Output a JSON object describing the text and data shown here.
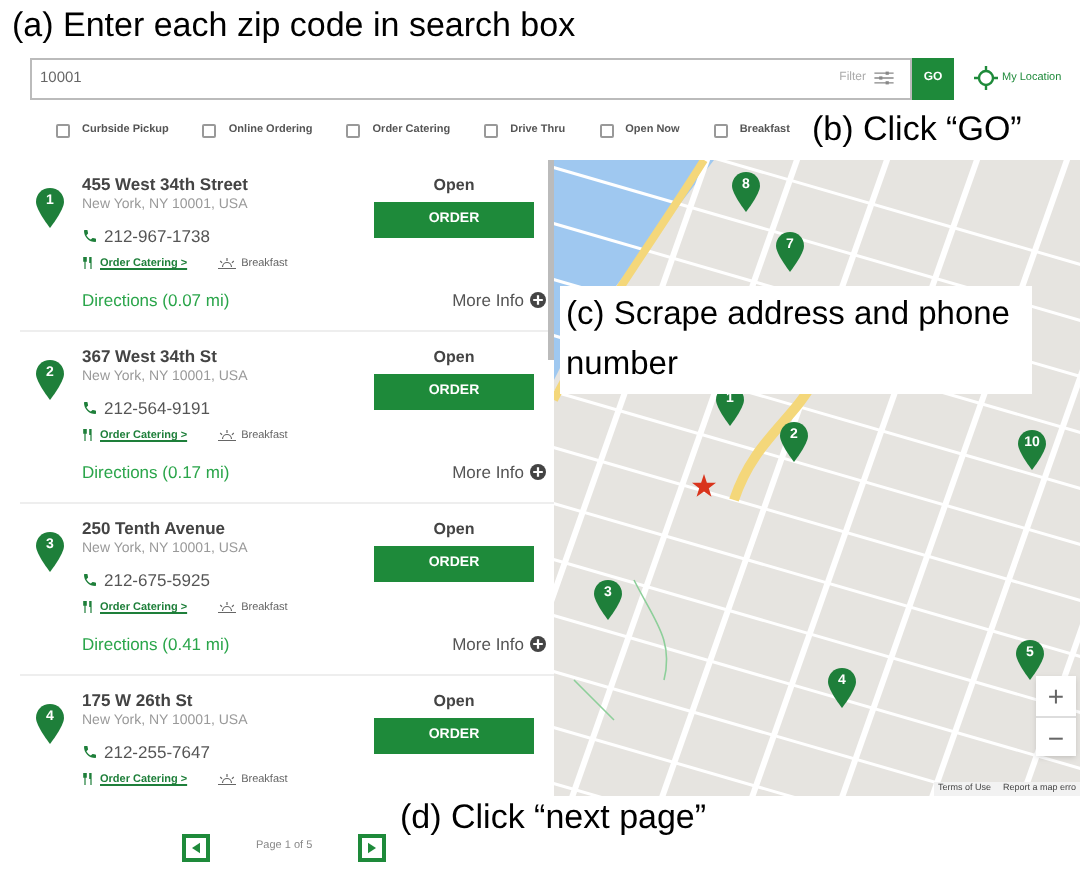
{
  "annotations": [
    {
      "text": "(a) Enter each zip code in search box"
    },
    {
      "text": "(b) Click “GO”"
    },
    {
      "text": "(c) Scrape address and phone number"
    },
    {
      "text": "(d) Click “next page”"
    }
  ],
  "search": {
    "value": "10001",
    "filter_label": "Filter",
    "button": "GO",
    "my_location": "My Location"
  },
  "filters": [
    {
      "label": "Curbside Pickup",
      "checked": false
    },
    {
      "label": "Online Ordering",
      "checked": false
    },
    {
      "label": "Order Catering",
      "checked": false
    },
    {
      "label": "Drive Thru",
      "checked": false
    },
    {
      "label": "Open Now",
      "checked": false
    },
    {
      "label": "Breakfast",
      "checked": false
    }
  ],
  "locations": [
    {
      "pin": "1",
      "name": "455 West 34th Street",
      "address": "New York, NY 10001, USA",
      "phone": "212-967-1738",
      "catering": "Order Catering >",
      "feature": "Breakfast",
      "status": "Open",
      "order": "ORDER",
      "directions": "Directions (0.07 mi)",
      "more_info": "More Info"
    },
    {
      "pin": "2",
      "name": "367 West 34th St",
      "address": "New York, NY 10001, USA",
      "phone": "212-564-9191",
      "catering": "Order Catering >",
      "feature": "Breakfast",
      "status": "Open",
      "order": "ORDER",
      "directions": "Directions (0.17 mi)",
      "more_info": "More Info"
    },
    {
      "pin": "3",
      "name": "250 Tenth Avenue",
      "address": "New York, NY 10001, USA",
      "phone": "212-675-5925",
      "catering": "Order Catering >",
      "feature": "Breakfast",
      "status": "Open",
      "order": "ORDER",
      "directions": "Directions (0.41 mi)",
      "more_info": "More Info"
    },
    {
      "pin": "4",
      "name": "175 W 26th St",
      "address": "New York, NY 10001, USA",
      "phone": "212-255-7647",
      "catering": "Order Catering >",
      "feature": "Breakfast",
      "status": "Open",
      "order": "ORDER"
    }
  ],
  "pagination": {
    "page_text": "Page 1 of 5"
  },
  "map": {
    "pins": [
      {
        "label": "8"
      },
      {
        "label": "7"
      },
      {
        "label": "1"
      },
      {
        "label": "2"
      },
      {
        "label": "10"
      },
      {
        "label": "3"
      },
      {
        "label": "4"
      },
      {
        "label": "5"
      }
    ],
    "zoom_in": "+",
    "zoom_out": "−",
    "terms": "Terms of Use",
    "report": "Report a map erro"
  }
}
